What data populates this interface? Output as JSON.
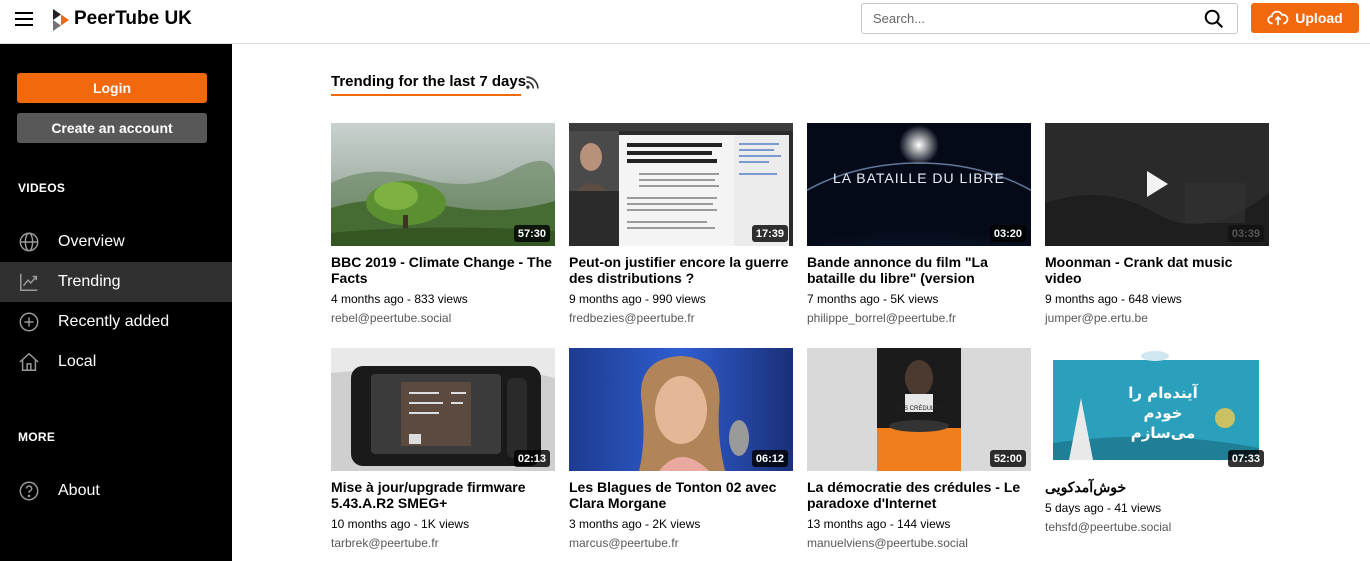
{
  "header": {
    "app_title": "PeerTube UK",
    "search_placeholder": "Search...",
    "upload_label": "Upload",
    "brand_color": "#f1680d"
  },
  "sidebar": {
    "login_label": "Login",
    "create_account_label": "Create an account",
    "videos_section": "VIDEOS",
    "more_section": "MORE",
    "items": [
      {
        "label": "Overview",
        "icon": "globe-icon",
        "active": false
      },
      {
        "label": "Trending",
        "icon": "trending-icon",
        "active": true
      },
      {
        "label": "Recently added",
        "icon": "plus-circle-icon",
        "active": false
      },
      {
        "label": "Local",
        "icon": "home-icon",
        "active": false
      }
    ],
    "more_items": [
      {
        "label": "About",
        "icon": "help-icon"
      }
    ]
  },
  "main": {
    "title": "Trending for the last 7 days",
    "videos": [
      {
        "title": "BBC 2019 - Climate Change - The Facts",
        "meta": "4 months ago - 833 views",
        "account": "rebel@peertube.social",
        "duration": "57:30"
      },
      {
        "title": "Peut-on justifier encore la guerre des distributions ?",
        "meta": "9 months ago - 990 views",
        "account": "fredbezies@peertube.fr",
        "duration": "17:39"
      },
      {
        "title": "Bande annonce du film \"La bataille du libre\" (version",
        "meta": "7 months ago - 5K views",
        "account": "philippe_borrel@peertube.fr",
        "duration": "03:20"
      },
      {
        "title": "Moonman - Crank dat music video",
        "meta": "9 months ago - 648 views",
        "account": "jumper@pe.ertu.be",
        "duration": "03:39"
      },
      {
        "title": "Mise à jour/upgrade firmware 5.43.A.R2 SMEG+",
        "meta": "10 months ago - 1K views",
        "account": "tarbrek@peertube.fr",
        "duration": "02:13"
      },
      {
        "title": "Les Blagues de Tonton 02 avec Clara Morgane",
        "meta": "3 months ago - 2K views",
        "account": "marcus@peertube.fr",
        "duration": "06:12"
      },
      {
        "title": "La démocratie des crédules - Le paradoxe d'Internet",
        "meta": "13 months ago - 144 views",
        "account": "manuelviens@peertube.social",
        "duration": "52:00"
      },
      {
        "title": "خوش‌آمدکویی",
        "meta": "5 days ago - 41 views",
        "account": "tehsfd@peertube.social",
        "duration": "07:33"
      }
    ]
  }
}
